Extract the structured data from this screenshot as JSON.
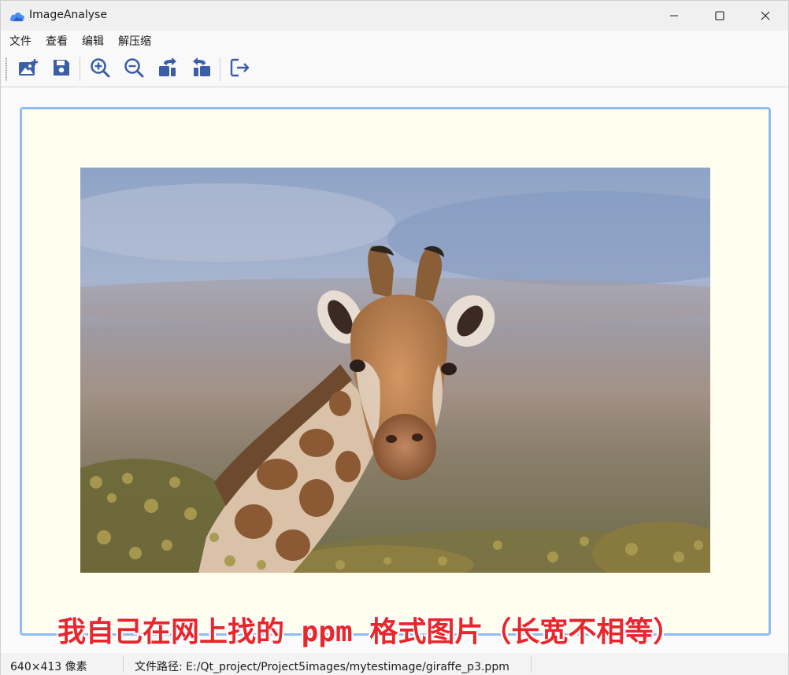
{
  "window": {
    "title": "ImageAnalyse",
    "icon": "cloud-icon",
    "controls": [
      "minimize-icon",
      "maximize-icon",
      "close-icon"
    ]
  },
  "menu": {
    "items": [
      {
        "label": "文件"
      },
      {
        "label": "查看"
      },
      {
        "label": "编辑"
      },
      {
        "label": "解压缩"
      }
    ]
  },
  "toolbar": {
    "buttons": [
      {
        "icon": "open-image-icon"
      },
      {
        "icon": "save-icon"
      },
      {
        "icon": "zoom-in-icon"
      },
      {
        "icon": "zoom-out-icon"
      },
      {
        "icon": "rotate-right-icon"
      },
      {
        "icon": "rotate-left-icon"
      },
      {
        "icon": "exit-icon"
      }
    ]
  },
  "image": {
    "subject": "giraffe-photo"
  },
  "annotation": {
    "text": "我自己在网上找的 ppm 格式图片（长宽不相等）"
  },
  "status": {
    "size": "640×413 像素",
    "path": "文件路径: E:/Qt_project/Project5images/mytestimage/giraffe_p3.ppm"
  },
  "colors": {
    "accent": "#3a5ea8",
    "frame_border": "#8fbdf2",
    "frame_bg": "#fffdee",
    "annotation": "#e8262c"
  }
}
